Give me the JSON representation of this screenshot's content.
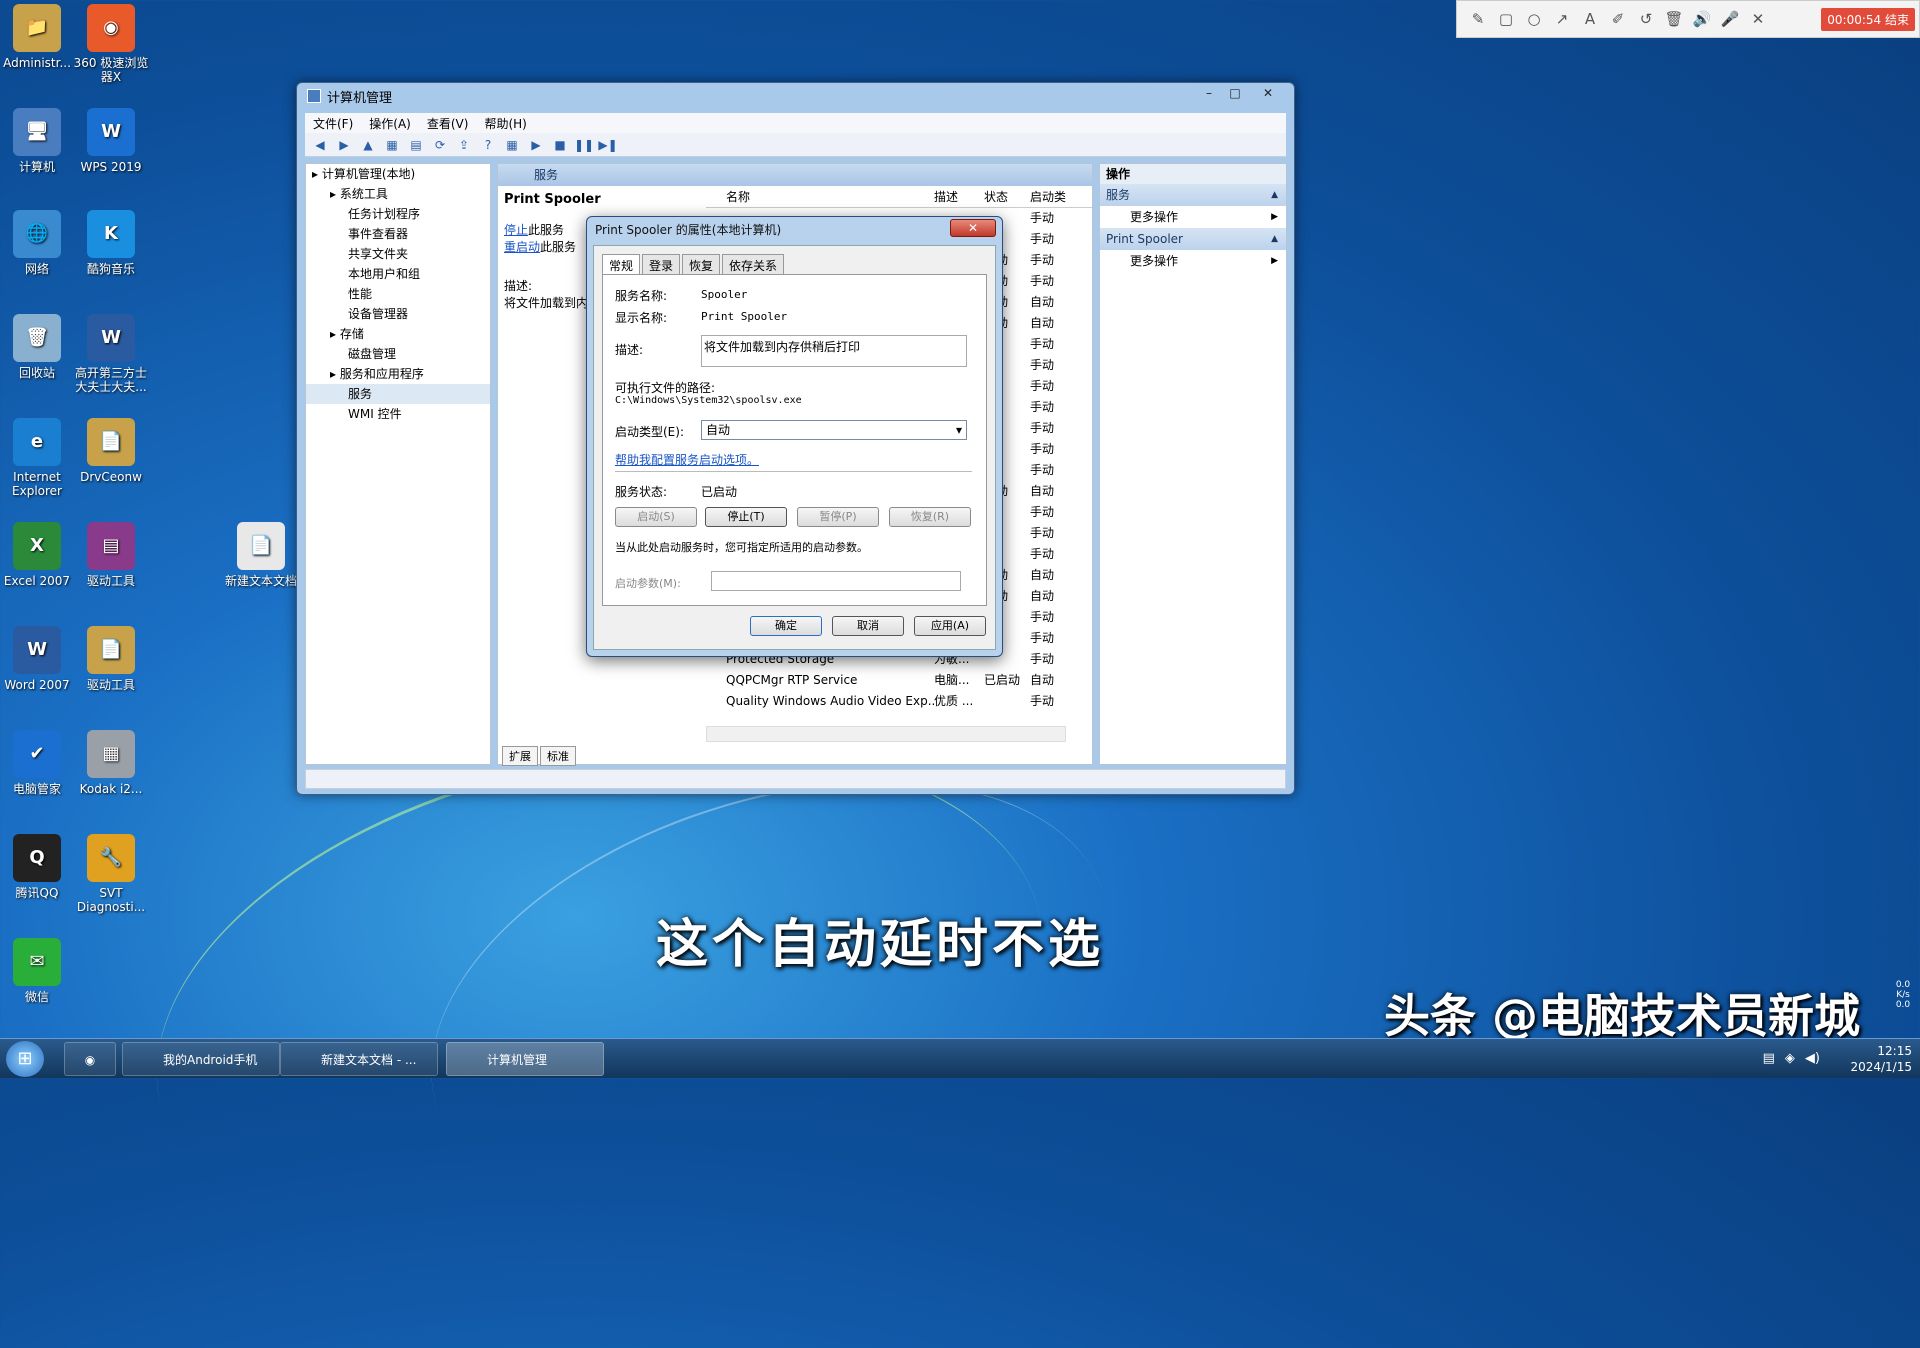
{
  "desktop": {
    "icons": [
      {
        "label": "Administr...",
        "glyph": "📁",
        "color": "#c8a24a"
      },
      {
        "label": "360 极速浏览器X",
        "glyph": "◉",
        "color": "#e85a2a"
      },
      {
        "label": "计算机",
        "glyph": "🖥",
        "color": "#4a7cc0"
      },
      {
        "label": "WPS 2019",
        "glyph": "W",
        "color": "#1a6fd0"
      },
      {
        "label": "网络",
        "glyph": "🌐",
        "color": "#3a8ad0"
      },
      {
        "label": "酷狗音乐",
        "glyph": "K",
        "color": "#1a8fe0"
      },
      {
        "label": "回收站",
        "glyph": "🗑",
        "color": "#8ab0d0"
      },
      {
        "label": "高开第三方士大夫士大夫...",
        "glyph": "W",
        "color": "#2a5aa0"
      },
      {
        "label": "Internet Explorer",
        "glyph": "e",
        "color": "#1a7fd0"
      },
      {
        "label": "DrvCeonw",
        "glyph": "📄",
        "color": "#c8a24a"
      },
      {
        "label": "Excel 2007",
        "glyph": "X",
        "color": "#2a8a3a"
      },
      {
        "label": "驱动工具",
        "glyph": "▤",
        "color": "#8a3a8a"
      },
      {
        "label": "新建文本文档",
        "glyph": "📄",
        "color": "#e8e8e8"
      },
      {
        "label": "Word 2007",
        "glyph": "W",
        "color": "#2a5aa0"
      },
      {
        "label": "驱动工具",
        "glyph": "📄",
        "color": "#c8a24a"
      },
      {
        "label": "电脑管家",
        "glyph": "✔",
        "color": "#1a6fd0"
      },
      {
        "label": "Kodak i2...",
        "glyph": "▦",
        "color": "#9aa0a8"
      },
      {
        "label": "腾讯QQ",
        "glyph": "Q",
        "color": "#222"
      },
      {
        "label": "SVT Diagnosti...",
        "glyph": "🔧",
        "color": "#e0a020"
      },
      {
        "label": "微信",
        "glyph": "✉",
        "color": "#2aae3a"
      }
    ]
  },
  "recorder": {
    "tools": [
      "✎",
      "▢",
      "○",
      "↗",
      "A",
      "✐",
      "↺",
      "🗑",
      "🔊",
      "🎤",
      "✕"
    ],
    "timer": "00:00:54 结束"
  },
  "window": {
    "title": "计算机管理",
    "menu": [
      "文件(F)",
      "操作(A)",
      "查看(V)",
      "帮助(H)"
    ],
    "toolbar": [
      "◀",
      "▶",
      "▲",
      "▦",
      "▤",
      "⟳",
      "⇪",
      "?",
      "▦",
      "▶",
      "■",
      "❚❚",
      "▶❚"
    ],
    "tree": [
      {
        "label": "计算机管理(本地)",
        "indent": 0
      },
      {
        "label": "系统工具",
        "indent": 1
      },
      {
        "label": "任务计划程序",
        "indent": 2
      },
      {
        "label": "事件查看器",
        "indent": 2
      },
      {
        "label": "共享文件夹",
        "indent": 2
      },
      {
        "label": "本地用户和组",
        "indent": 2
      },
      {
        "label": "性能",
        "indent": 2
      },
      {
        "label": "设备管理器",
        "indent": 2
      },
      {
        "label": "存储",
        "indent": 1
      },
      {
        "label": "磁盘管理",
        "indent": 2
      },
      {
        "label": "服务和应用程序",
        "indent": 1
      },
      {
        "label": "服务",
        "indent": 2
      },
      {
        "label": "WMI 控件",
        "indent": 2
      }
    ],
    "center_header": "服务",
    "service_title": "Print Spooler",
    "stop_link": "停止",
    "stop_suffix": "此服务",
    "restart_link": "重启动",
    "restart_suffix": "此服务",
    "desc_label": "描述:",
    "desc_text": "将文件加载到内存",
    "columns": {
      "name": "名称",
      "desc": "描述",
      "state": "状态",
      "startup": "启动类"
    },
    "rows": [
      {
        "name": "",
        "desc": "",
        "state": "",
        "startup": "手动"
      },
      {
        "name": "",
        "desc": "",
        "state": "",
        "startup": "手动"
      },
      {
        "name": "",
        "desc": "",
        "state": "启动",
        "startup": "手动"
      },
      {
        "name": "",
        "desc": "",
        "state": "启动",
        "startup": "手动"
      },
      {
        "name": "",
        "desc": "",
        "state": "启动",
        "startup": "自动"
      },
      {
        "name": "",
        "desc": "",
        "state": "启动",
        "startup": "自动"
      },
      {
        "name": "",
        "desc": "",
        "state": "",
        "startup": "手动"
      },
      {
        "name": "",
        "desc": "",
        "state": "",
        "startup": "手动"
      },
      {
        "name": "",
        "desc": "",
        "state": "",
        "startup": "手动"
      },
      {
        "name": "",
        "desc": "",
        "state": "",
        "startup": "手动"
      },
      {
        "name": "",
        "desc": "",
        "state": "",
        "startup": "手动"
      },
      {
        "name": "",
        "desc": "",
        "state": "",
        "startup": "手动"
      },
      {
        "name": "",
        "desc": "",
        "state": "",
        "startup": "手动"
      },
      {
        "name": "",
        "desc": "",
        "state": "启动",
        "startup": "自动"
      },
      {
        "name": "",
        "desc": "",
        "state": "",
        "startup": "手动"
      },
      {
        "name": "",
        "desc": "",
        "state": "",
        "startup": "手动"
      },
      {
        "name": "",
        "desc": "",
        "state": "",
        "startup": "手动"
      },
      {
        "name": "",
        "desc": "",
        "state": "启动",
        "startup": "自动"
      },
      {
        "name": "",
        "desc": "",
        "state": "启动",
        "startup": "自动"
      },
      {
        "name": "",
        "desc": "",
        "state": "",
        "startup": "手动"
      },
      {
        "name": "",
        "desc": "",
        "state": "",
        "startup": "手动"
      },
      {
        "name": "Protected Storage",
        "desc": "为敏...",
        "state": "",
        "startup": "手动"
      },
      {
        "name": "QQPCMgr RTP Service",
        "desc": "电脑...",
        "state": "已启动",
        "startup": "自动"
      },
      {
        "name": "Quality Windows Audio Video Exp...",
        "desc": "优质 ...",
        "state": "",
        "startup": "手动"
      }
    ],
    "bottom_tabs": [
      "扩展",
      "标准"
    ],
    "actions_title": "操作",
    "action_sections": [
      {
        "title": "服务",
        "item": "更多操作"
      },
      {
        "title": "Print Spooler",
        "item": "更多操作"
      }
    ]
  },
  "dialog": {
    "title": "Print Spooler 的属性(本地计算机)",
    "close": "✕",
    "tabs": [
      "常规",
      "登录",
      "恢复",
      "依存关系"
    ],
    "service_name_label": "服务名称:",
    "service_name": "Spooler",
    "display_name_label": "显示名称:",
    "display_name": "Print Spooler",
    "desc_label": "描述:",
    "desc": "将文件加载到内存供稍后打印",
    "path_label": "可执行文件的路径:",
    "path": "C:\\Windows\\System32\\spoolsv.exe",
    "startup_type_label": "启动类型(E):",
    "startup_type": "自动",
    "help_link": "帮助我配置服务启动选项。",
    "status_label": "服务状态:",
    "status": "已启动",
    "btn_start": "启动(S)",
    "btn_stop": "停止(T)",
    "btn_pause": "暂停(P)",
    "btn_resume": "恢复(R)",
    "hint": "当从此处启动服务时，您可指定所适用的启动参数。",
    "param_label": "启动参数(M):",
    "btn_ok": "确定",
    "btn_cancel": "取消",
    "btn_apply": "应用(A)"
  },
  "caption": "这个自动延时不选",
  "watermark": "头条 @电脑技术员新城",
  "taskbar": {
    "start": "⊞",
    "buttons": [
      "",
      "我的Android手机",
      "新建文本文档 - ...",
      "计算机管理"
    ],
    "time": "12:15",
    "date": "2024/1/15"
  },
  "netmeter": {
    "up": "0.0",
    "down": "0.0",
    "unit": "K/s"
  }
}
